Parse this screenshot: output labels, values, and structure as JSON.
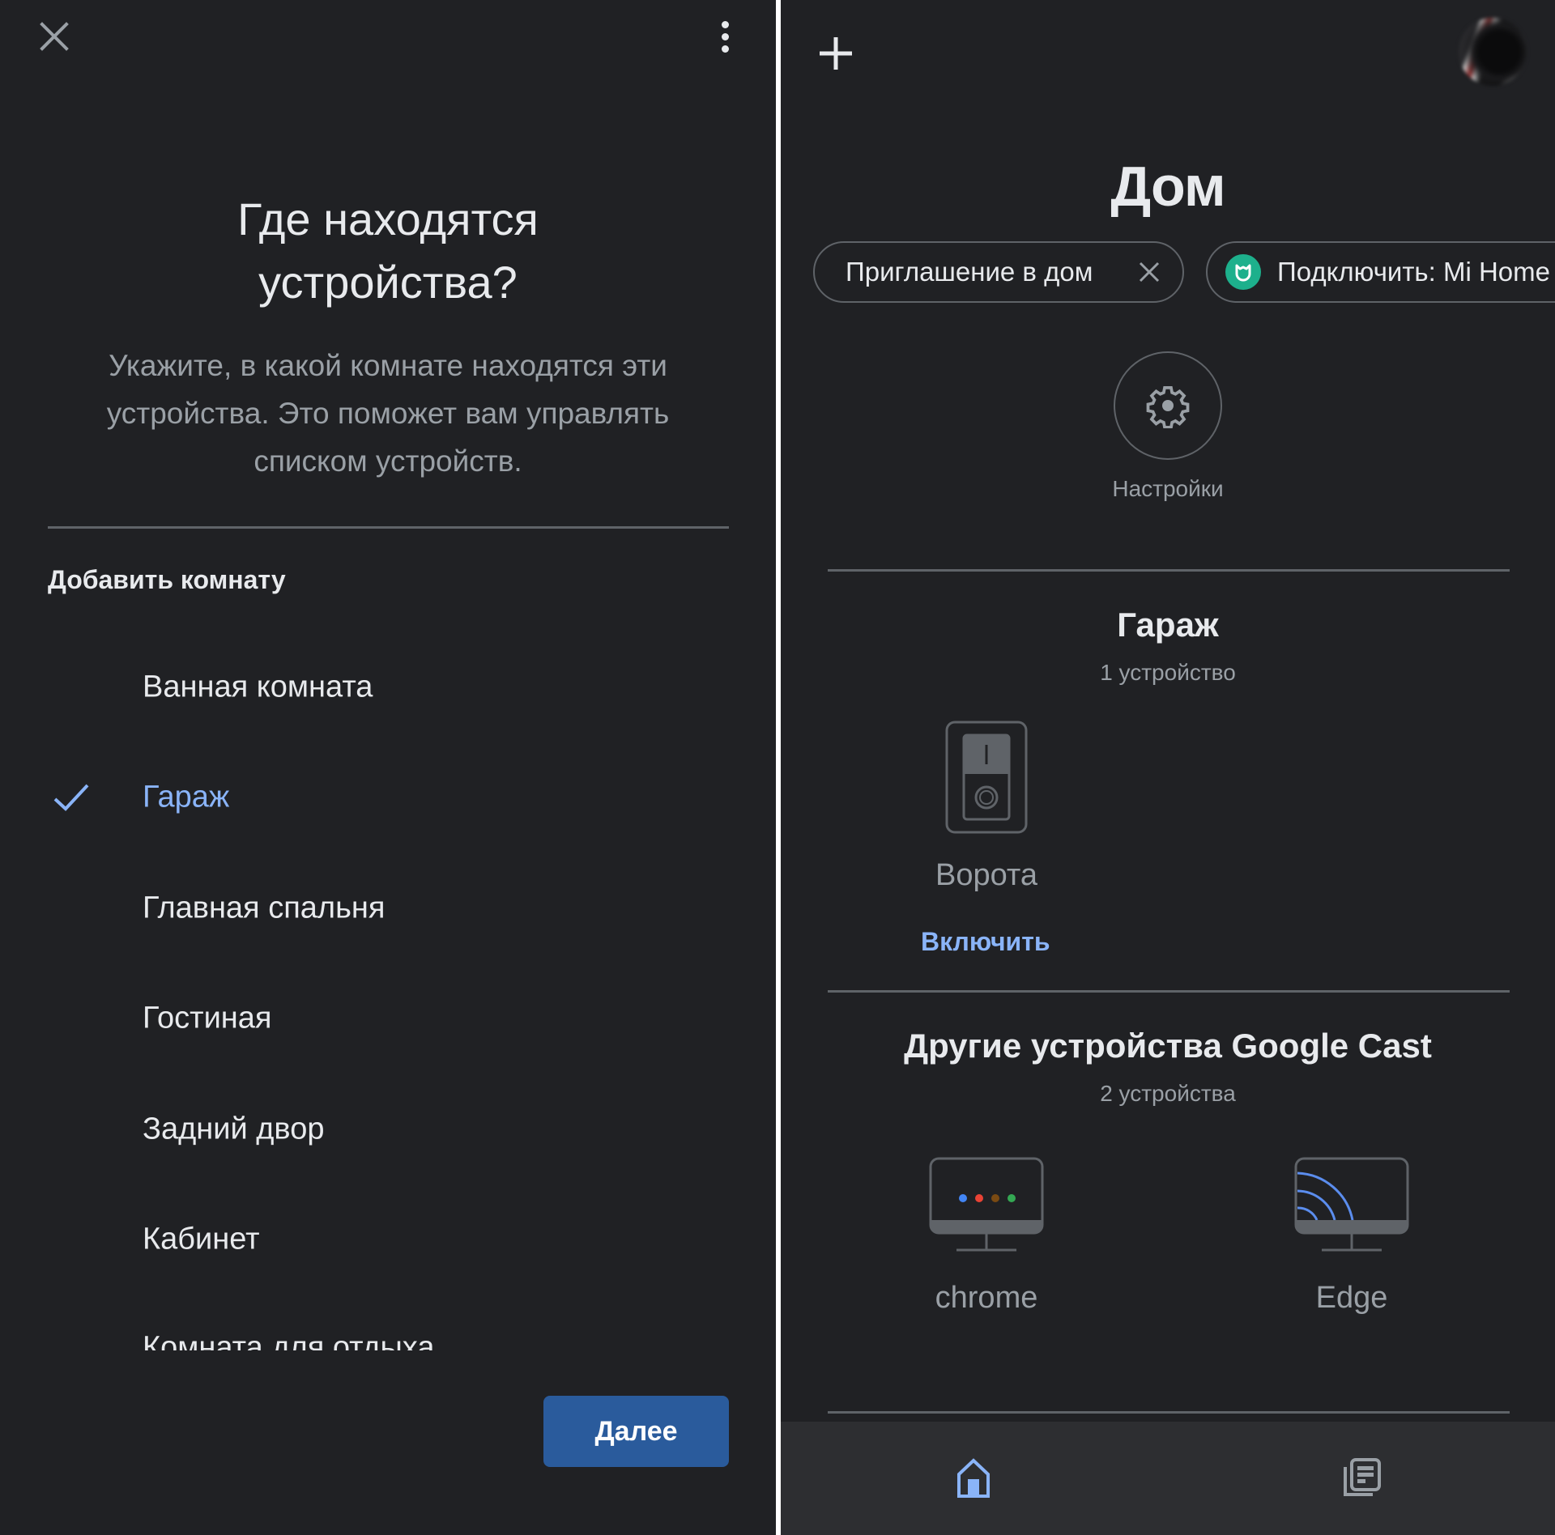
{
  "left": {
    "close_icon": "close-icon",
    "menu_icon": "more-vert-icon",
    "title": "Где находятся устройства?",
    "description": "Укажите, в какой комнате находятся эти устройства. Это поможет вам управлять списком устройств.",
    "add_room_label": "Добавить комнату",
    "rooms": [
      {
        "label": "Ванная комната",
        "selected": false
      },
      {
        "label": "Гараж",
        "selected": true
      },
      {
        "label": "Главная спальня",
        "selected": false
      },
      {
        "label": "Гостиная",
        "selected": false
      },
      {
        "label": "Задний двор",
        "selected": false
      },
      {
        "label": "Кабинет",
        "selected": false
      },
      {
        "label": "Комната для отдыха",
        "selected": false
      }
    ],
    "next_label": "Далее",
    "colors": {
      "accent": "#8ab4f8",
      "button": "#2a5b9c"
    }
  },
  "right": {
    "add_icon": "plus-icon",
    "avatar": "account-avatar",
    "home_title": "Дом",
    "chips": [
      {
        "label": "Приглашение в дом",
        "icon": "close-icon"
      },
      {
        "label": "Подключить: Mi Home",
        "icon": "mi-home-logo"
      }
    ],
    "settings_label": "Настройки",
    "sections": [
      {
        "title": "Гараж",
        "subtitle": "1 устройство",
        "devices": [
          {
            "name": "Ворота",
            "icon": "switch-icon",
            "action": "Включить"
          }
        ]
      },
      {
        "title": "Другие устройства Google Cast",
        "subtitle": "2 устройства",
        "devices": [
          {
            "name": "chrome",
            "icon": "display-google-dots-icon"
          },
          {
            "name": "Edge",
            "icon": "display-cast-icon"
          }
        ]
      }
    ],
    "nav": [
      {
        "name": "home",
        "icon": "home-icon",
        "active": true
      },
      {
        "name": "feed",
        "icon": "feed-icon",
        "active": false
      }
    ],
    "colors": {
      "mi_green": "#1db08c",
      "google_dots": [
        "#4285f4",
        "#ea4335",
        "#7a4a12",
        "#34a853"
      ],
      "cast_blue": "#5b8dee"
    }
  }
}
